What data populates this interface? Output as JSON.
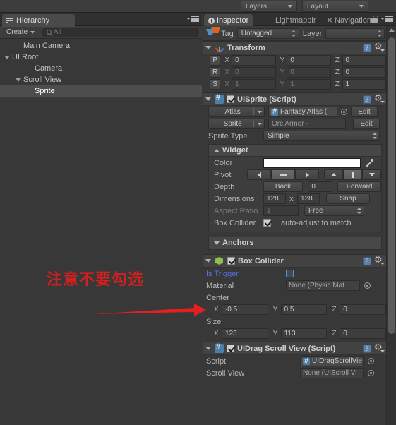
{
  "toolbar": {
    "layers_label": "Layers",
    "layout_label": "Layout"
  },
  "hierarchy": {
    "tab_label": "Hierarchy",
    "create_label": "Create",
    "search_placeholder": "All",
    "items": [
      {
        "label": "Main Camera",
        "depth": 1,
        "expandable": false,
        "selected": false
      },
      {
        "label": "UI Root",
        "depth": 0,
        "expandable": true,
        "selected": false
      },
      {
        "label": "Camera",
        "depth": 2,
        "expandable": false,
        "selected": false
      },
      {
        "label": "Scroll View",
        "depth": 1,
        "expandable": true,
        "selected": false
      },
      {
        "label": "Sprite",
        "depth": 2,
        "expandable": false,
        "selected": true
      }
    ]
  },
  "inspector": {
    "tabs": [
      {
        "label": "Inspector",
        "active": true
      },
      {
        "label": "Lightmappir",
        "active": false
      },
      {
        "label": "Navigation",
        "active": false
      }
    ],
    "gameobject": {
      "tag_label": "Tag",
      "tag_value": "Untagged",
      "layer_label": "Layer",
      "layer_value": ""
    },
    "transform": {
      "title": "Transform",
      "rows": [
        {
          "key": "P",
          "x_label": "X",
          "x": "0",
          "y_label": "Y",
          "y": "0",
          "z_label": "Z",
          "z": "0",
          "dim": false
        },
        {
          "key": "R",
          "x_label": "X",
          "x": "0",
          "y_label": "Y",
          "y": "0",
          "z_label": "Z",
          "z": "0",
          "dim": true
        },
        {
          "key": "S",
          "x_label": "X",
          "x": "1",
          "y_label": "Y",
          "y": "1",
          "z_label": "Z",
          "z": "1",
          "dim": true
        }
      ]
    },
    "uisprite": {
      "title": "UISprite (Script)",
      "enabled": true,
      "atlas_label": "Atlas",
      "atlas_value": "Fantasy Atlas (",
      "atlas_edit": "Edit",
      "sprite_label": "Sprite",
      "sprite_value": "Orc Armor -",
      "sprite_edit": "Edit",
      "sprite_type_label": "Sprite Type",
      "sprite_type_value": "Simple"
    },
    "widget": {
      "title": "Widget",
      "color_label": "Color",
      "color_value": "#ffffff",
      "pivot_label": "Pivot",
      "depth_label": "Depth",
      "depth_back": "Back",
      "depth_value": "0",
      "depth_forward": "Forward",
      "dimensions_label": "Dimensions",
      "dimensions_x": "128",
      "dimensions_sep": "x",
      "dimensions_y": "128",
      "snap_label": "Snap",
      "aspect_label": "Aspect Ratio",
      "aspect_value": "1",
      "aspect_mode": "Free",
      "boxcollider_label": "Box Collider",
      "boxcollider_checked": true,
      "autoadjust_label": "auto-adjust to match"
    },
    "anchors": {
      "title": "Anchors"
    },
    "boxcollider": {
      "title": "Box Collider",
      "enabled": true,
      "is_trigger_label": "Is Trigger",
      "is_trigger_checked": false,
      "material_label": "Material",
      "material_value": "None (Physic Mat",
      "center_label": "Center",
      "center": {
        "x_label": "X",
        "x": "-0.5",
        "y_label": "Y",
        "y": "0.5",
        "z_label": "Z",
        "z": "0"
      },
      "size_label": "Size",
      "size": {
        "x_label": "X",
        "x": "123",
        "y_label": "Y",
        "y": "113",
        "z_label": "Z",
        "z": "0"
      }
    },
    "uidragscrollview": {
      "title": "UIDrag Scroll View (Script)",
      "enabled": true,
      "script_label": "Script",
      "script_value": "UIDragScrollVie",
      "scrollview_label": "Scroll View",
      "scrollview_value": "None (UIScroll Vi"
    }
  },
  "annotation": {
    "text": "注意不要勾选",
    "color": "#d41f1f"
  }
}
